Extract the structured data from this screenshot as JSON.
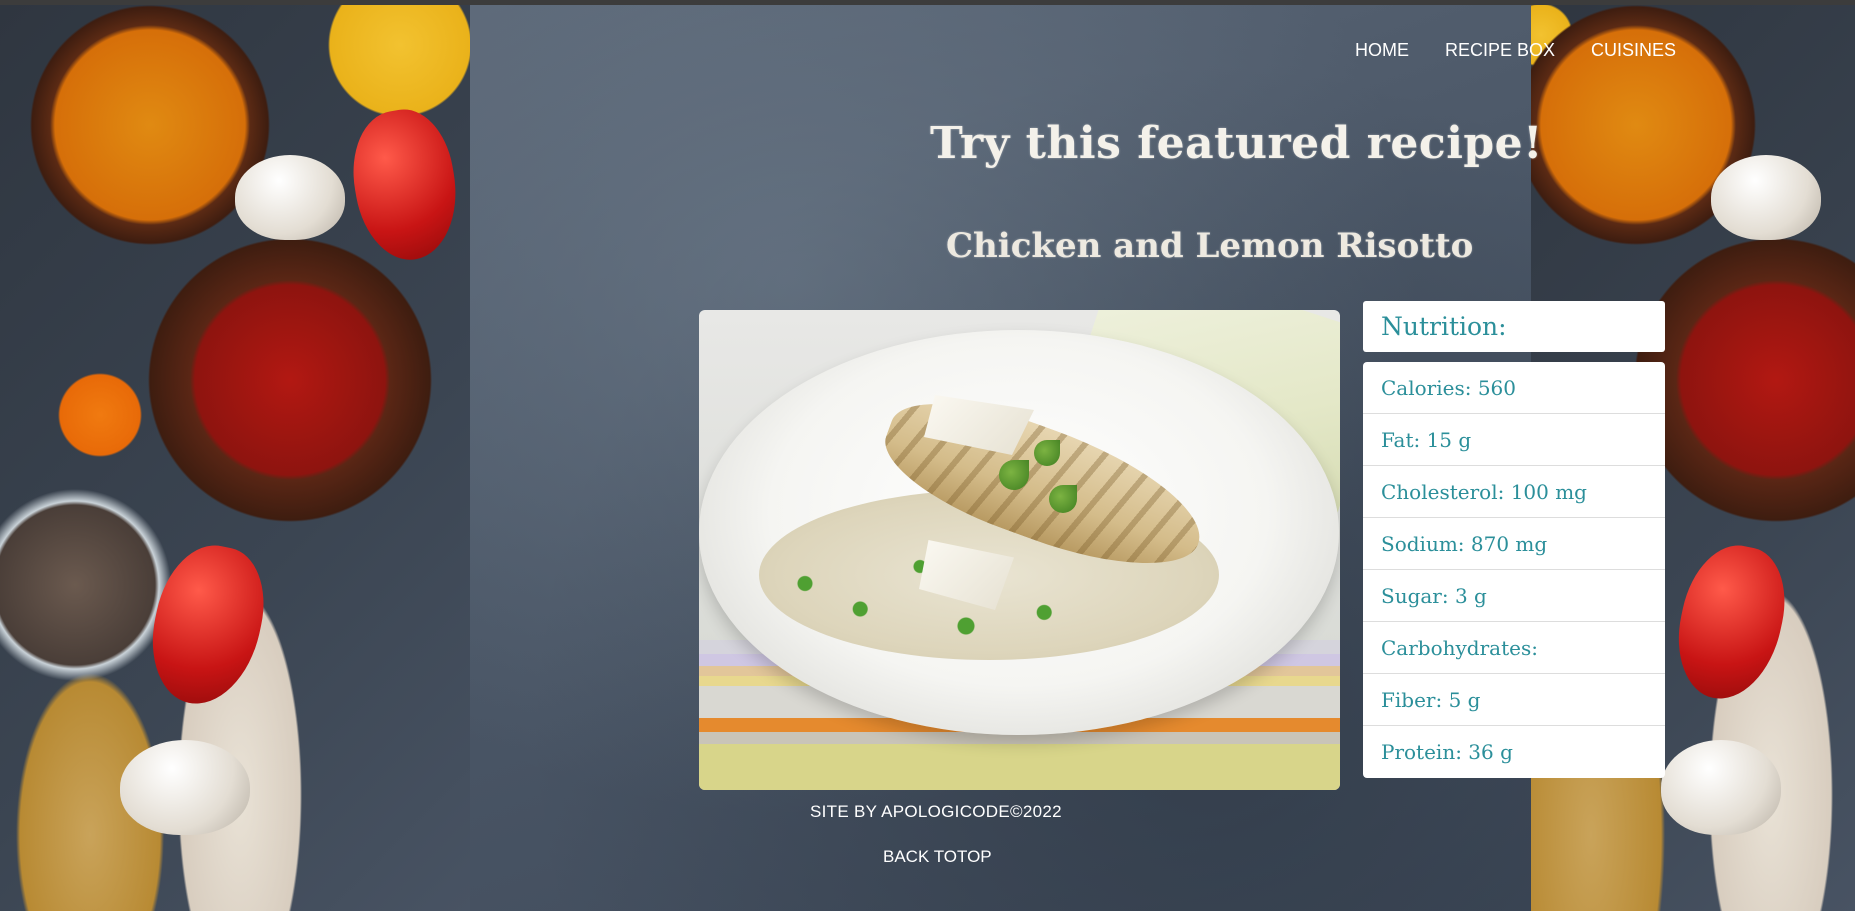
{
  "nav": {
    "items": [
      "HOME",
      "RECIPE BOX",
      "CUISINES"
    ]
  },
  "hero": {
    "title": "Try this featured recipe!",
    "recipe_name": "Chicken and Lemon Risotto"
  },
  "nutrition": {
    "heading": "Nutrition:",
    "items": [
      "Calories: 560",
      "Fat: 15 g",
      "Cholesterol: 100 mg",
      "Sodium: 870 mg",
      "Sugar: 3 g",
      "Carbohydrates:",
      "Fiber: 5 g",
      "Protein: 36 g"
    ]
  },
  "footer": {
    "credit": "SITE BY APOLOGICODE©2022",
    "back_to_top": "BACK TOTOP"
  },
  "colors": {
    "accent_teal": "#2b8f9a",
    "background_slate": "#4a5566",
    "panel_white": "#ffffff"
  }
}
